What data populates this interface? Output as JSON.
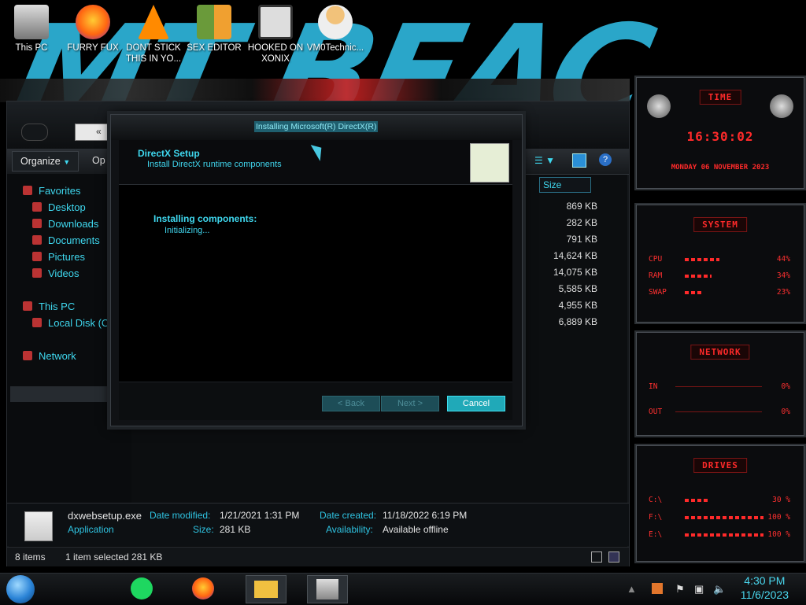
{
  "desktop": {
    "icons": [
      {
        "label": "This PC"
      },
      {
        "label": "FURRY FUX"
      },
      {
        "label": "DONT STICK THIS IN YO..."
      },
      {
        "label": "SEX EDITOR"
      },
      {
        "label": "HOOKED ON XONIX"
      },
      {
        "label": "VM0Technic..."
      }
    ]
  },
  "explorer": {
    "breadcrumb": "«",
    "toolbar": {
      "organize_label": "Organize",
      "partial_label": "Op"
    },
    "nav": {
      "favorites": "Favorites",
      "desktop": "Desktop",
      "downloads": "Downloads",
      "documents": "Documents",
      "pictures": "Pictures",
      "videos": "Videos",
      "this_pc": "This PC",
      "local_disk": "Local Disk (C",
      "network": "Network"
    },
    "column_header": "Size",
    "sizes": [
      "869 KB",
      "282 KB",
      "791 KB",
      "14,624 KB",
      "14,075 KB",
      "5,585 KB",
      "4,955 KB",
      "6,889 KB"
    ],
    "details": {
      "file_name": "dxwebsetup.exe",
      "file_type": "Application",
      "date_modified_key": "Date modified:",
      "date_modified_val": "1/21/2021 1:31 PM",
      "size_key": "Size:",
      "size_val": "281 KB",
      "date_created_key": "Date created:",
      "date_created_val": "11/18/2022 6:19 PM",
      "availability_key": "Availability:",
      "availability_val": "Available offline"
    },
    "status": {
      "items": "8 items",
      "selected": "1 item selected  281 KB"
    }
  },
  "dialog": {
    "title": "Installing Microsoft(R) DirectX(R)",
    "heading": "DirectX Setup",
    "subheading": "Install DirectX runtime components",
    "progress_heading": "Installing components:",
    "progress_status": "Initializing...",
    "back_label": "< Back",
    "next_label": "Next >",
    "cancel_label": "Cancel"
  },
  "widgets": {
    "time": {
      "title": "TIME",
      "clock": "16:30:02",
      "date": "MONDAY 06 NOVEMBER 2023"
    },
    "system": {
      "title": "SYSTEM",
      "cpu_label": "CPU",
      "cpu_val": "44%",
      "cpu_pct": 44,
      "ram_label": "RAM",
      "ram_val": "34%",
      "ram_pct": 34,
      "swap_label": "SWAP",
      "swap_val": "23%",
      "swap_pct": 23
    },
    "network": {
      "title": "NETWORK",
      "in_label": "IN",
      "in_val": "0%",
      "out_label": "OUT",
      "out_val": "0%"
    },
    "drives": {
      "title": "DRIVES",
      "c_label": "C:\\",
      "c_val": "30 %",
      "c_pct": 30,
      "f_label": "F:\\",
      "f_val": "100 %",
      "f_pct": 100,
      "e_label": "E:\\",
      "e_val": "100 %",
      "e_pct": 100
    }
  },
  "taskbar": {
    "clock_time": "4:30 PM",
    "clock_date": "11/6/2023"
  },
  "colors": {
    "accent": "#3fd8ef",
    "widget_red": "#ff2a2a"
  }
}
